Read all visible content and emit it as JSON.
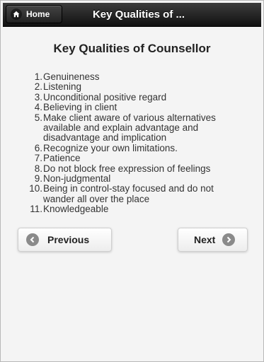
{
  "header": {
    "home_label": "Home",
    "home_icon": "home-icon",
    "title": "Key Qualities of ..."
  },
  "main": {
    "title": "Key Qualities of Counsellor",
    "items": [
      {
        "num": "1.",
        "lines": [
          "Genuineness"
        ]
      },
      {
        "num": "2.",
        "lines": [
          "Listening"
        ]
      },
      {
        "num": "3.",
        "lines": [
          "Unconditional positive regard"
        ]
      },
      {
        "num": "4.",
        "lines": [
          "Believing in client"
        ]
      },
      {
        "num": "5.",
        "lines": [
          "Make client aware of various alternatives",
          "available and explain advantage and",
          "disadvantage and implication"
        ]
      },
      {
        "num": "6.",
        "lines": [
          "Recognize your own limitations."
        ]
      },
      {
        "num": "7.",
        "lines": [
          "Patience"
        ]
      },
      {
        "num": "8.",
        "lines": [
          "Do not block free expression of feelings"
        ]
      },
      {
        "num": "9.",
        "lines": [
          "Non-judgmental"
        ]
      },
      {
        "num": "10.",
        "lines": [
          "Being in control-stay focused and do not",
          "wander all over the place"
        ]
      },
      {
        "num": "11.",
        "lines": [
          "Knowledgeable"
        ]
      }
    ]
  },
  "nav": {
    "previous_label": "Previous",
    "previous_icon": "arrow-left-icon",
    "next_label": "Next",
    "next_icon": "arrow-right-icon"
  }
}
